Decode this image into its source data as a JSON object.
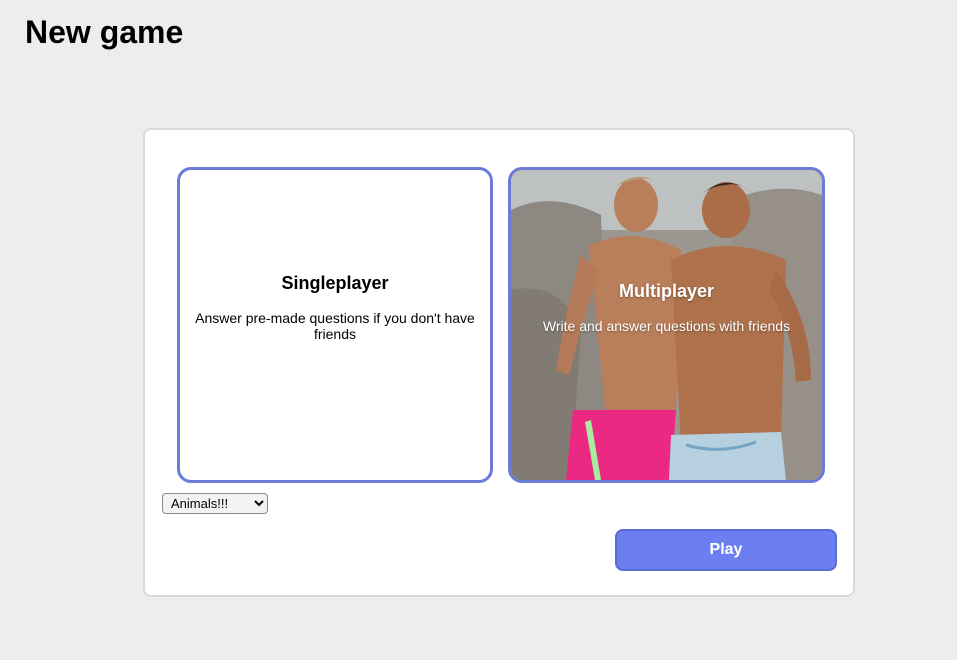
{
  "page": {
    "title": "New game"
  },
  "modes": {
    "singleplayer": {
      "title": "Singleplayer",
      "description": "Answer pre-made questions if you don't have friends"
    },
    "multiplayer": {
      "title": "Multiplayer",
      "description": "Write and answer questions with friends",
      "background_image": "photo of two shirtless men on rocks"
    }
  },
  "category_select": {
    "selected": "Animals!!!",
    "options": [
      "Animals!!!"
    ]
  },
  "actions": {
    "play_label": "Play"
  },
  "colors": {
    "accent": "#6b7bd6",
    "play_button": "#6b7ff0",
    "background": "#ededed",
    "panel_border": "#d9d9d9"
  }
}
